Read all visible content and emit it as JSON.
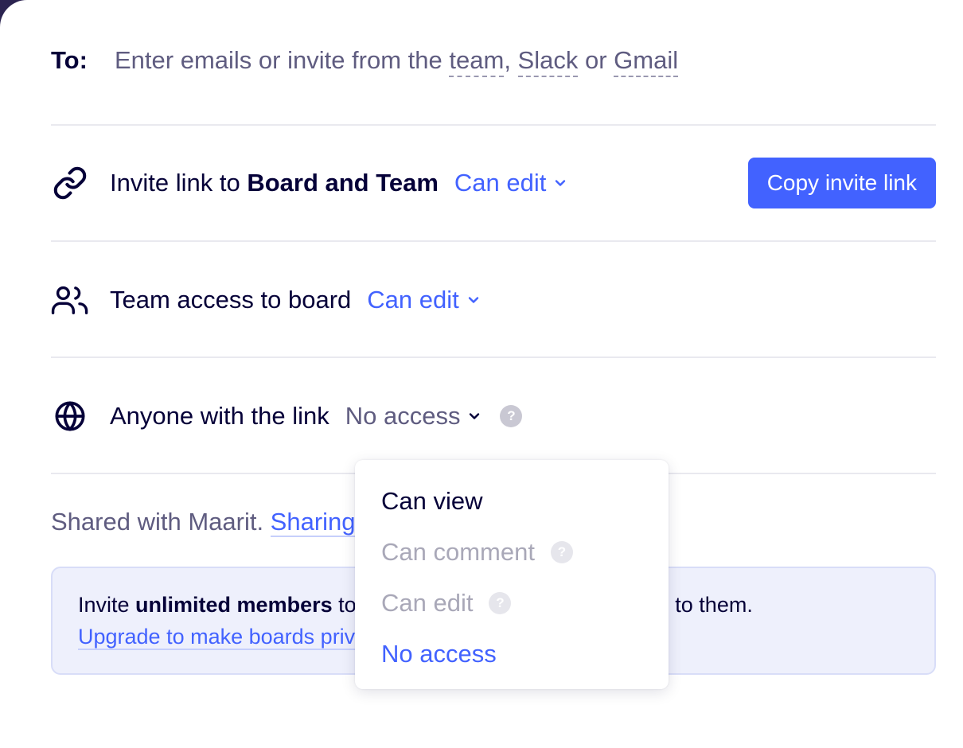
{
  "to": {
    "label": "To:",
    "placeholder_prefix": "Enter emails or invite from the ",
    "team_link": "team",
    "sep1": ", ",
    "slack_link": "Slack",
    "sep2": " or ",
    "gmail_link": "Gmail"
  },
  "invite_link": {
    "prefix": "Invite link to ",
    "target": "Board and Team",
    "permission": "Can edit",
    "copy_button": "Copy invite link"
  },
  "team_access": {
    "label": "Team access to board",
    "permission": "Can edit"
  },
  "anyone": {
    "label": "Anyone with the link",
    "permission": "No access",
    "help": "?"
  },
  "shared": {
    "text": "Shared with Maarit. ",
    "link": "Sharing settings"
  },
  "banner": {
    "line1_prefix": "Invite ",
    "line1_bold": "unlimited members",
    "line1_suffix": " to your team. Boards will be visible to them.",
    "line2": "Upgrade to make boards private"
  },
  "menu": {
    "items": [
      {
        "label": "Can view",
        "state": "enabled"
      },
      {
        "label": "Can comment",
        "state": "disabled",
        "help": "?"
      },
      {
        "label": "Can edit",
        "state": "disabled",
        "help": "?"
      },
      {
        "label": "No access",
        "state": "selected"
      }
    ]
  },
  "colors": {
    "accent": "#4262ff",
    "text": "#050038",
    "muted": "#5f5c80",
    "background": "#2b2350"
  }
}
